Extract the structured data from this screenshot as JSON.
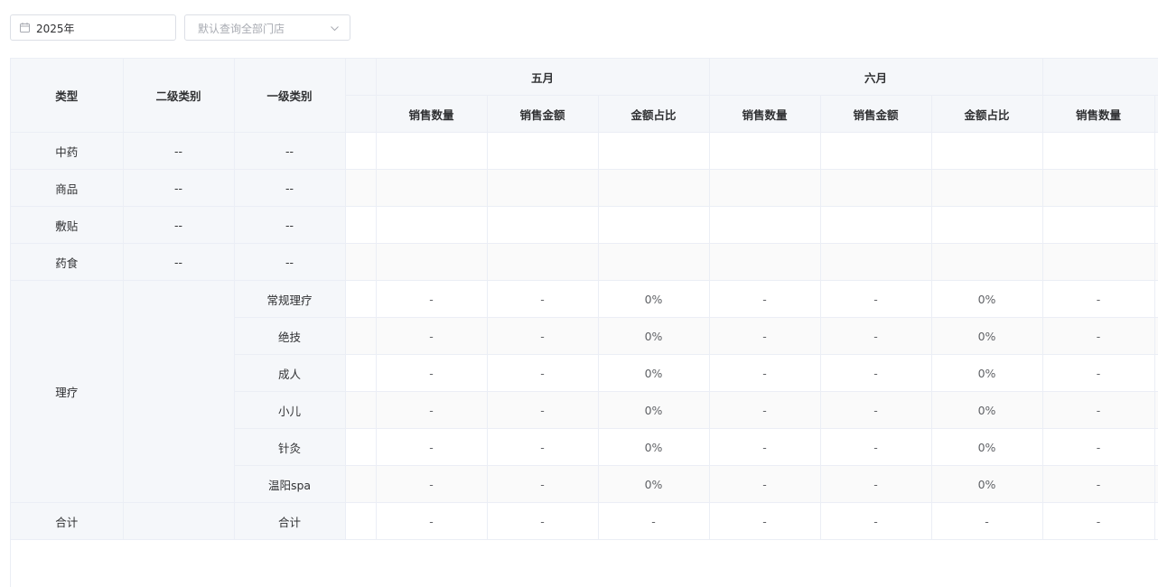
{
  "filters": {
    "year": "2025年",
    "store_placeholder": "默认查询全部门店"
  },
  "headers": {
    "type": "类型",
    "second_category": "二级类别",
    "first_category": "一级类别",
    "months": [
      "五月",
      "六月"
    ],
    "sub_cols": [
      "销售数量",
      "销售金额",
      "金额占比"
    ]
  },
  "rows": [
    {
      "type": "中药",
      "second": "--",
      "first": "--",
      "values": [
        "",
        "",
        "",
        "",
        "",
        "",
        ""
      ]
    },
    {
      "type": "商品",
      "second": "--",
      "first": "--",
      "values": [
        "",
        "",
        "",
        "",
        "",
        "",
        ""
      ]
    },
    {
      "type": "敷贴",
      "second": "--",
      "first": "--",
      "values": [
        "",
        "",
        "",
        "",
        "",
        "",
        ""
      ]
    },
    {
      "type": "药食",
      "second": "--",
      "first": "--",
      "values": [
        "",
        "",
        "",
        "",
        "",
        "",
        ""
      ]
    },
    {
      "type": "理疗",
      "second": "",
      "first": "常规理疗",
      "values": [
        "-",
        "-",
        "0%",
        "-",
        "-",
        "0%",
        "-"
      ]
    },
    {
      "type": "",
      "second": "",
      "first": "绝技",
      "values": [
        "-",
        "-",
        "0%",
        "-",
        "-",
        "0%",
        "-"
      ]
    },
    {
      "type": "",
      "second": "",
      "first": "成人",
      "values": [
        "-",
        "-",
        "0%",
        "-",
        "-",
        "0%",
        "-"
      ]
    },
    {
      "type": "",
      "second": "",
      "first": "小儿",
      "values": [
        "-",
        "-",
        "0%",
        "-",
        "-",
        "0%",
        "-"
      ]
    },
    {
      "type": "",
      "second": "",
      "first": "针灸",
      "values": [
        "-",
        "-",
        "0%",
        "-",
        "-",
        "0%",
        "-"
      ]
    },
    {
      "type": "",
      "second": "",
      "first": "温阳spa",
      "values": [
        "-",
        "-",
        "0%",
        "-",
        "-",
        "0%",
        "-"
      ]
    },
    {
      "type": "合计",
      "second": "",
      "first": "合计",
      "values": [
        "-",
        "-",
        "-",
        "-",
        "-",
        "-",
        "-"
      ]
    }
  ]
}
